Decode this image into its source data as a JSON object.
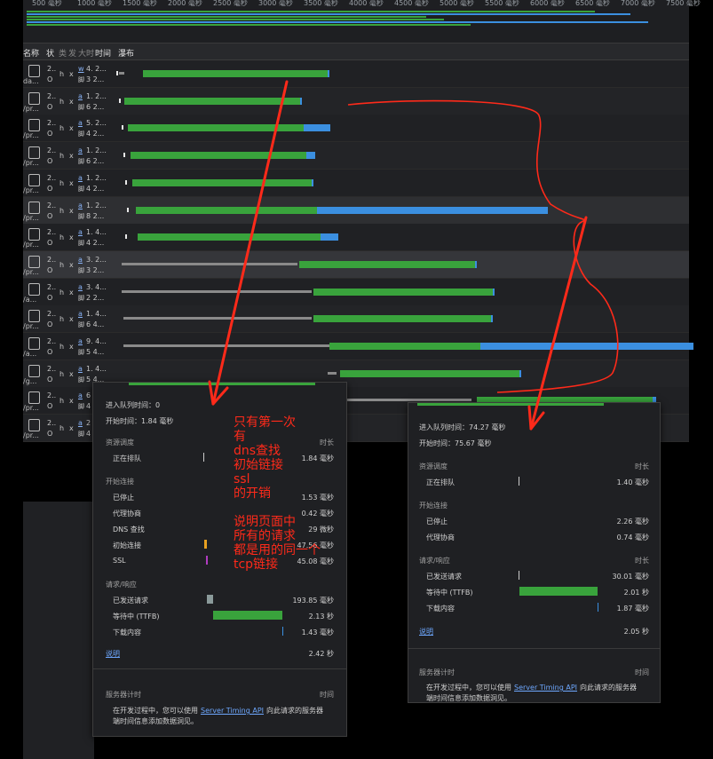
{
  "overview": {
    "ticks": [
      "500 毫秒",
      "1000 毫秒",
      "1500 毫秒",
      "2000 毫秒",
      "2500 毫秒",
      "3000 毫秒",
      "3500 毫秒",
      "4000 毫秒",
      "4500 毫秒",
      "5000 毫秒",
      "5500 毫秒",
      "6000 毫秒",
      "6500 毫秒",
      "7000 毫秒",
      "7500 毫秒"
    ]
  },
  "table": {
    "headers": [
      "名称",
      "状",
      "类",
      "发",
      "大",
      "时",
      "时间",
      "瀑布"
    ],
    "rows": [
      {
        "name": "da...",
        "status": "2..",
        "status2": "O",
        "type": "h",
        "init": "x",
        "size": "w",
        "size2": "脚",
        "time": "4. 2...",
        "time2": "3 2..."
      },
      {
        "name": "/pr...",
        "status": "2..",
        "status2": "O",
        "type": "h",
        "init": "x",
        "size": "a",
        "size2": "脚",
        "time": "1. 2...",
        "time2": "6 2..."
      },
      {
        "name": "/pr...",
        "status": "2..",
        "status2": "O",
        "type": "h",
        "init": "x",
        "size": "a",
        "size2": "脚",
        "time": "5. 2...",
        "time2": "4 2..."
      },
      {
        "name": "/pr...",
        "status": "2..",
        "status2": "O",
        "type": "h",
        "init": "x",
        "size": "a",
        "size2": "脚",
        "time": "1. 2...",
        "time2": "6 2..."
      },
      {
        "name": "/pr...",
        "status": "2..",
        "status2": "O",
        "type": "h",
        "init": "x",
        "size": "a",
        "size2": "脚",
        "time": "1. 2...",
        "time2": "4 2..."
      },
      {
        "name": "/pr...",
        "status": "2..",
        "status2": "O",
        "type": "h",
        "init": "x",
        "size": "a",
        "size2": "脚",
        "time": "1. 2...",
        "time2": "8 2..."
      },
      {
        "name": "/pr...",
        "status": "2..",
        "status2": "O",
        "type": "h",
        "init": "x",
        "size": "a",
        "size2": "脚",
        "time": "1. 4...",
        "time2": "4 2..."
      },
      {
        "name": "/pr...",
        "status": "2..",
        "status2": "O",
        "type": "h",
        "init": "x",
        "size": "a",
        "size2": "脚",
        "time": "3. 2...",
        "time2": "3 2..."
      },
      {
        "name": "/a...",
        "status": "2..",
        "status2": "O",
        "type": "h",
        "init": "x",
        "size": "a",
        "size2": "脚",
        "time": "3. 4...",
        "time2": "2 2..."
      },
      {
        "name": "/pr...",
        "status": "2..",
        "status2": "O",
        "type": "h",
        "init": "x",
        "size": "a",
        "size2": "脚",
        "time": "1. 4...",
        "time2": "6 4..."
      },
      {
        "name": "/a...",
        "status": "2..",
        "status2": "O",
        "type": "h",
        "init": "x",
        "size": "a",
        "size2": "脚",
        "time": "9. 4...",
        "time2": "5 4..."
      },
      {
        "name": "/g...",
        "status": "2..",
        "status2": "O",
        "type": "h",
        "init": "x",
        "size": "a",
        "size2": "脚",
        "time": "1. 4...",
        "time2": "5 4..."
      },
      {
        "name": "/pr...",
        "status": "2..",
        "status2": "O",
        "type": "h",
        "init": "x",
        "size": "a",
        "size2": "脚",
        "time": "6",
        "time2": "4"
      },
      {
        "name": "/pr...",
        "status": "2..",
        "status2": "O",
        "type": "h",
        "init": "x",
        "size": "a",
        "size2": "脚",
        "time": "2",
        "time2": "4"
      }
    ]
  },
  "popup_left": {
    "queued_at": "进入队列时间：0",
    "started_at": "开始时间：1.84 毫秒",
    "section_scheduling": "资源调度",
    "duration_header": "时长",
    "queueing_label": "正在排队",
    "queueing_value": "1.84 毫秒",
    "section_connection": "开始连接",
    "stalled_label": "已停止",
    "stalled_value": "1.53 毫秒",
    "proxy_label": "代理协商",
    "proxy_value": "0.42 毫秒",
    "dns_label": "DNS 查找",
    "dns_value": "29 微秒",
    "initial_label": "初始连接",
    "initial_value": "47.56 毫秒",
    "ssl_label": "SSL",
    "ssl_value": "45.08 毫秒",
    "section_request": "请求/响应",
    "request_sent_label": "已发送请求",
    "request_sent_value": "193.85 毫秒",
    "ttfb_label": "等待中 (TTFB)",
    "ttfb_value": "2.13 秒",
    "download_label": "下载内容",
    "download_value": "1.43 毫秒",
    "explain_link": "说明",
    "total_value": "2.42 秒",
    "server_timing_title": "服务器计时",
    "time_header": "时间",
    "server_text_1": "在开发过程中，您可以使用",
    "server_link": "Server Timing API",
    "server_text_2": "向此请求的服务器",
    "server_text_3": "端时间信息添加数据洞见。"
  },
  "popup_right": {
    "queued_at": "进入队列时间：74.27 毫秒",
    "started_at": "开始时间：75.67 毫秒",
    "section_scheduling": "资源调度",
    "duration_header": "时长",
    "queueing_label": "正在排队",
    "queueing_value": "1.40 毫秒",
    "section_connection": "开始连接",
    "stalled_label": "已停止",
    "stalled_value": "2.26 毫秒",
    "proxy_label": "代理协商",
    "proxy_value": "0.74 毫秒",
    "section_request": "请求/响应",
    "request_sent_label": "已发送请求",
    "request_sent_value": "30.01 毫秒",
    "ttfb_label": "等待中 (TTFB)",
    "ttfb_value": "2.01 秒",
    "download_label": "下载内容",
    "download_value": "1.87 毫秒",
    "explain_link": "说明",
    "total_value": "2.05 秒",
    "server_timing_title": "服务器计时",
    "time_header": "时间",
    "server_text_1": "在开发过程中，您可以使用",
    "server_link": "Server Timing API",
    "server_text_2": "向此请求的服务器",
    "server_text_3": "端时间信息添加数据洞见。"
  },
  "annotation": {
    "lines": [
      "只有第一次",
      "有",
      "dns查找",
      "初始链接",
      "ssl",
      "的开销",
      "",
      "说明页面中",
      "所有的请求",
      "都是用的同一个",
      "tcp链接"
    ],
    "color": "#ff2a1a"
  },
  "colors": {
    "waiting": "#39a33c",
    "download": "#3b8fe0",
    "queue": "#8a8a8a"
  }
}
